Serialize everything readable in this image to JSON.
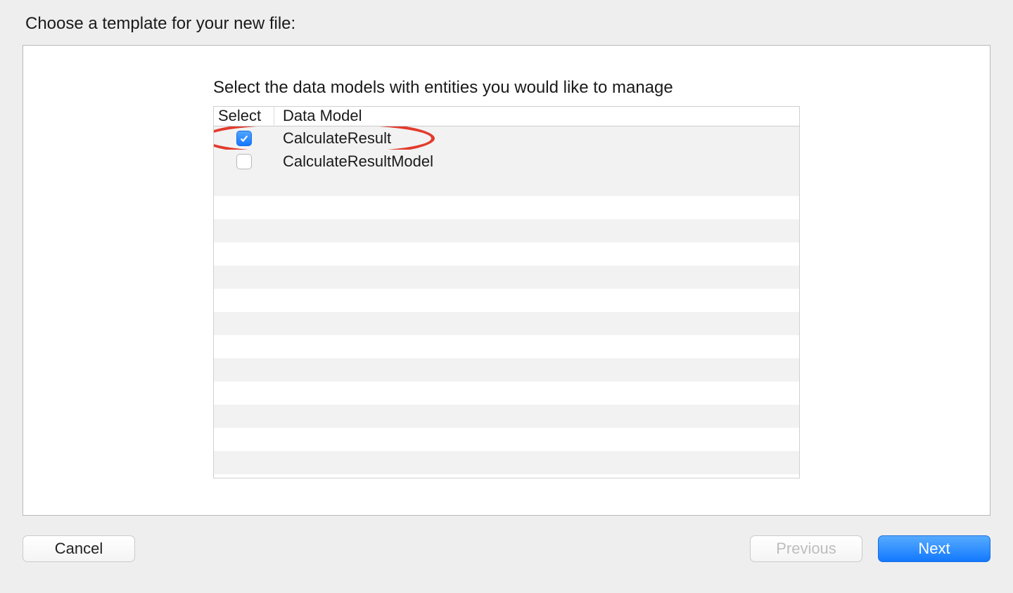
{
  "page_title": "Choose a template for your new file:",
  "instruction": "Select the data models with entities you would like to manage",
  "table": {
    "headers": {
      "select": "Select",
      "data_model": "Data Model"
    },
    "rows": [
      {
        "checked": true,
        "name": "CalculateResult",
        "highlighted": true
      },
      {
        "checked": false,
        "name": "CalculateResultModel",
        "highlighted": false
      }
    ],
    "empty_row_count": 13
  },
  "buttons": {
    "cancel": "Cancel",
    "previous": "Previous",
    "next": "Next"
  },
  "colors": {
    "accent": "#1577ff",
    "annotation": "#e23b2d"
  }
}
